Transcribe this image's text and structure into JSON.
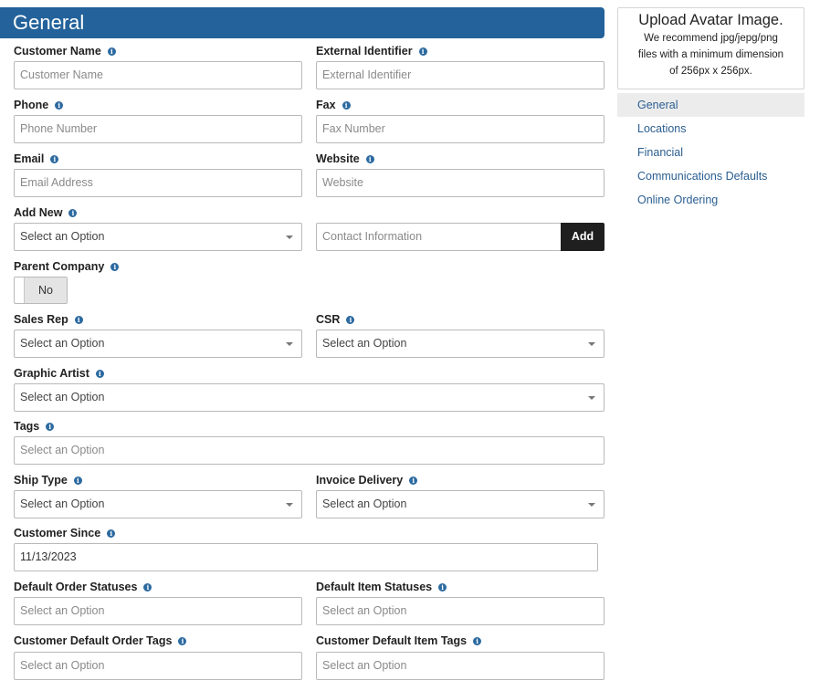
{
  "header": {
    "title": "General"
  },
  "fields": {
    "customer_name": {
      "label": "Customer Name",
      "placeholder": "Customer Name"
    },
    "external_identifier": {
      "label": "External Identifier",
      "placeholder": "External Identifier"
    },
    "phone": {
      "label": "Phone",
      "placeholder": "Phone Number"
    },
    "fax": {
      "label": "Fax",
      "placeholder": "Fax Number"
    },
    "email": {
      "label": "Email",
      "placeholder": "Email Address"
    },
    "website": {
      "label": "Website",
      "placeholder": "Website"
    },
    "add_new": {
      "label": "Add New",
      "select_value": "Select an Option",
      "contact_placeholder": "Contact Information",
      "button": "Add"
    },
    "parent_company": {
      "label": "Parent Company",
      "toggle_value": "No"
    },
    "sales_rep": {
      "label": "Sales Rep",
      "value": "Select an Option"
    },
    "csr": {
      "label": "CSR",
      "value": "Select an Option"
    },
    "graphic_artist": {
      "label": "Graphic Artist",
      "value": "Select an Option"
    },
    "tags": {
      "label": "Tags",
      "value": "Select an Option"
    },
    "ship_type": {
      "label": "Ship Type",
      "value": "Select an Option"
    },
    "invoice_delivery": {
      "label": "Invoice Delivery",
      "value": "Select an Option"
    },
    "customer_since": {
      "label": "Customer Since",
      "value": "11/13/2023"
    },
    "default_order_statuses": {
      "label": "Default Order Statuses",
      "value": "Select an Option"
    },
    "default_item_statuses": {
      "label": "Default Item Statuses",
      "value": "Select an Option"
    },
    "customer_default_order_tags": {
      "label": "Customer Default Order Tags",
      "value": "Select an Option"
    },
    "customer_default_item_tags": {
      "label": "Customer Default Item Tags",
      "value": "Select an Option"
    }
  },
  "avatar": {
    "title": "Upload Avatar Image.",
    "line1": "We recommend jpg/jepg/png",
    "line2": "files with a minimum dimension",
    "line3": "of 256px x 256px."
  },
  "sidenav": {
    "items": [
      {
        "label": "General",
        "active": true
      },
      {
        "label": "Locations"
      },
      {
        "label": "Financial"
      },
      {
        "label": "Communications Defaults"
      },
      {
        "label": "Online Ordering"
      }
    ]
  },
  "colors": {
    "header_bg": "#23629a",
    "link": "#2a5e91",
    "add_button_bg": "#1f1f1f",
    "info_icon": "#2c6aa0"
  }
}
